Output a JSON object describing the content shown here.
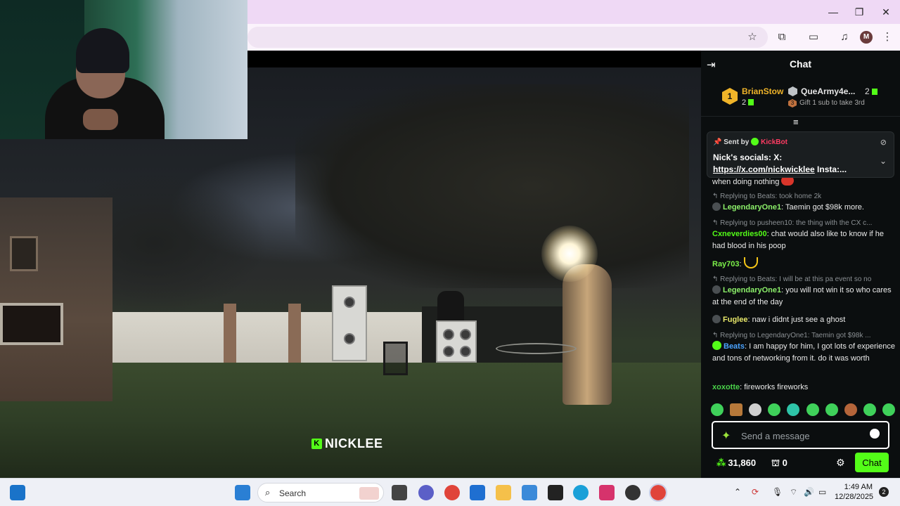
{
  "browser": {
    "window_controls": {
      "minimize": "—",
      "restore": "❐",
      "close": "✕"
    },
    "profile_initial": "M"
  },
  "stream": {
    "watermark": "NICKLEE",
    "kick_badge": "K"
  },
  "chat": {
    "title": "Chat",
    "leaderboard": {
      "first": {
        "rank": "1",
        "name": "BrianStow",
        "count": "2"
      },
      "second": {
        "name": "QueArmy4e...",
        "count": "2"
      },
      "third": {
        "rank": "3",
        "text": "Gift 1 sub to take 3rd"
      }
    },
    "pinned": {
      "sent_by_label": "Sent by",
      "bot_name": "KickBot",
      "text_prefix": "Nick's socials: X:",
      "link": "https://x.com/nickwicklee",
      "text_suffix": " Insta:..."
    },
    "messages": [
      {
        "type": "fragment",
        "text": "when doing nothing"
      },
      {
        "type": "reply",
        "text": "Replying to Beats: took home 2k"
      },
      {
        "type": "msg",
        "user": "LegendaryOne1",
        "color": "#8cf06a",
        "badge": "dot",
        "text": ": Taemin got $98k more."
      },
      {
        "type": "reply",
        "text": "Replying to pusheen10: the thing with the CX c..."
      },
      {
        "type": "msg",
        "user": "Cxneverdies00",
        "color": "#53fc18",
        "badge": "none",
        "text": ": chat would also like to know if he had blood in his poop"
      },
      {
        "type": "msg",
        "user": "Ray703",
        "color": "#7cf04a",
        "badge": "none",
        "text": ":"
      },
      {
        "type": "reply",
        "text": "Replying to Beats: I will be at this pa event so no"
      },
      {
        "type": "msg",
        "user": "LegendaryOne1",
        "color": "#8cf06a",
        "badge": "dot",
        "text": ": you will not win it so who cares at the end of the day"
      },
      {
        "type": "msg",
        "user": "Fuglee",
        "color": "#e8e86a",
        "badge": "dot",
        "text": ": naw i didnt just see a ghost"
      },
      {
        "type": "reply",
        "text": "Replying to LegendaryOne1: Taemin got $98k ..."
      },
      {
        "type": "msg",
        "user": "Beats",
        "color": "#4aa3ff",
        "badge": "verified",
        "text": ": I am happy for him, I got lots of experience and tons of networking from it. do it was worth"
      },
      {
        "type": "msg",
        "user": "xoxotte",
        "color": "#4ad24a",
        "badge": "none",
        "text": ": fireworks fireworks"
      }
    ],
    "input_placeholder": "Send a message",
    "points": "31,860",
    "drops": "0",
    "send_label": "Chat"
  },
  "taskbar": {
    "search_placeholder": "Search",
    "time": "1:49 AM",
    "date": "12/28/2025",
    "notification_count": "2"
  },
  "colors": {
    "kick_green": "#53fc18",
    "title_bar": "#efd9f5",
    "chat_bg": "#0b0e0f",
    "gold": "#f0b429"
  }
}
